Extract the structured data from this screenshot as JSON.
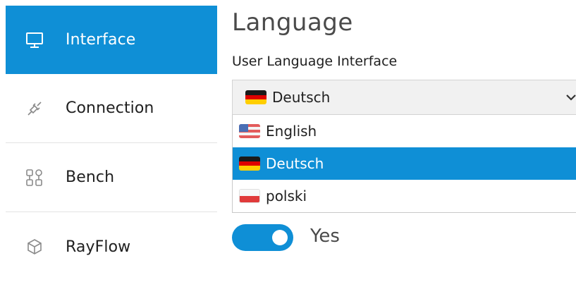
{
  "sidebar": {
    "items": [
      {
        "label": "Interface",
        "icon": "monitor-icon",
        "active": true
      },
      {
        "label": "Connection",
        "icon": "plug-icon",
        "active": false
      },
      {
        "label": "Bench",
        "icon": "bench-icon",
        "active": false
      },
      {
        "label": "RayFlow",
        "icon": "cube-icon",
        "active": false
      }
    ]
  },
  "main": {
    "title": "Language",
    "language_field": {
      "label": "User Language Interface",
      "selected_value": "Deutsch",
      "options": [
        {
          "label": "English",
          "flag": "us-flag-icon",
          "selected": false
        },
        {
          "label": "Deutsch",
          "flag": "german-flag-icon",
          "selected": true
        },
        {
          "label": "polski",
          "flag": "polish-flag-icon",
          "selected": false
        }
      ]
    },
    "toggle": {
      "label": "Yes",
      "on": true
    }
  },
  "colors": {
    "accent": "#0f8fd6",
    "divider": "#e3e3e3",
    "select_bg": "#f1f1f1"
  }
}
